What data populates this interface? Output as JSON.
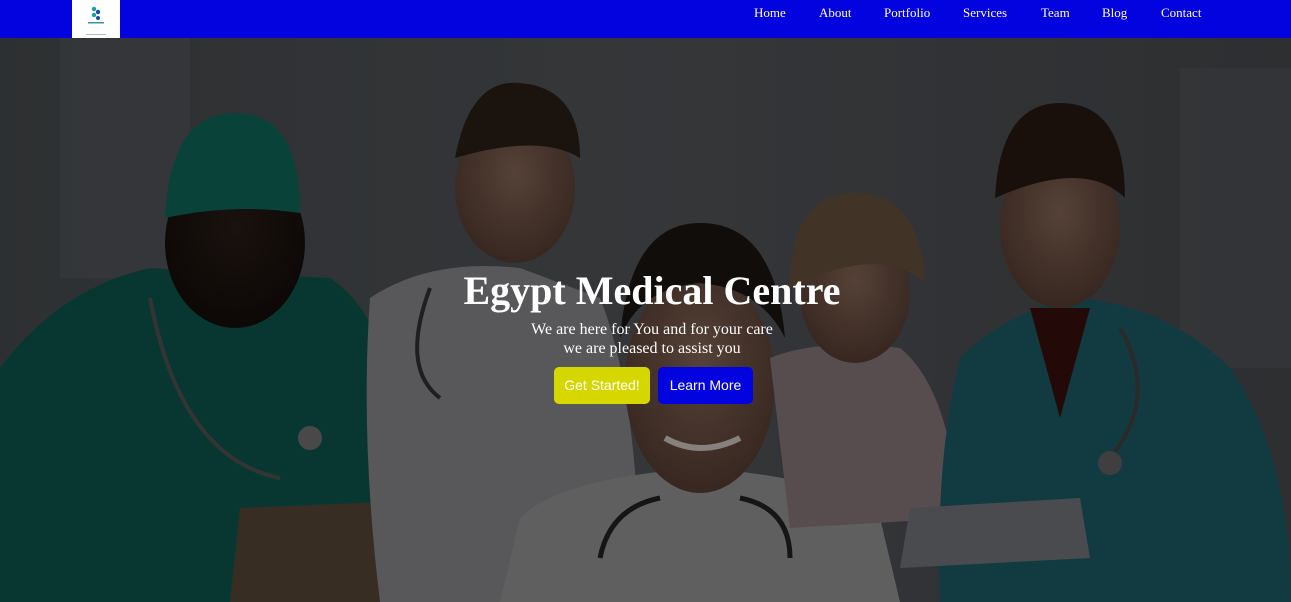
{
  "nav": {
    "links": [
      "Home",
      "About",
      "Portfolio",
      "Services",
      "Team",
      "Blog",
      "Contact"
    ]
  },
  "hero": {
    "title": "Egypt Medical Centre",
    "subtitle_line1": "We are here for You and for your care",
    "subtitle_line2": "we are pleased to assist you",
    "primary_button": "Get Started!",
    "secondary_button": "Learn More"
  },
  "colors": {
    "navbar": "#0303e0",
    "primary_button": "#d7d700",
    "secondary_button": "#0303e0"
  },
  "icons": [
    "logo-icon"
  ]
}
